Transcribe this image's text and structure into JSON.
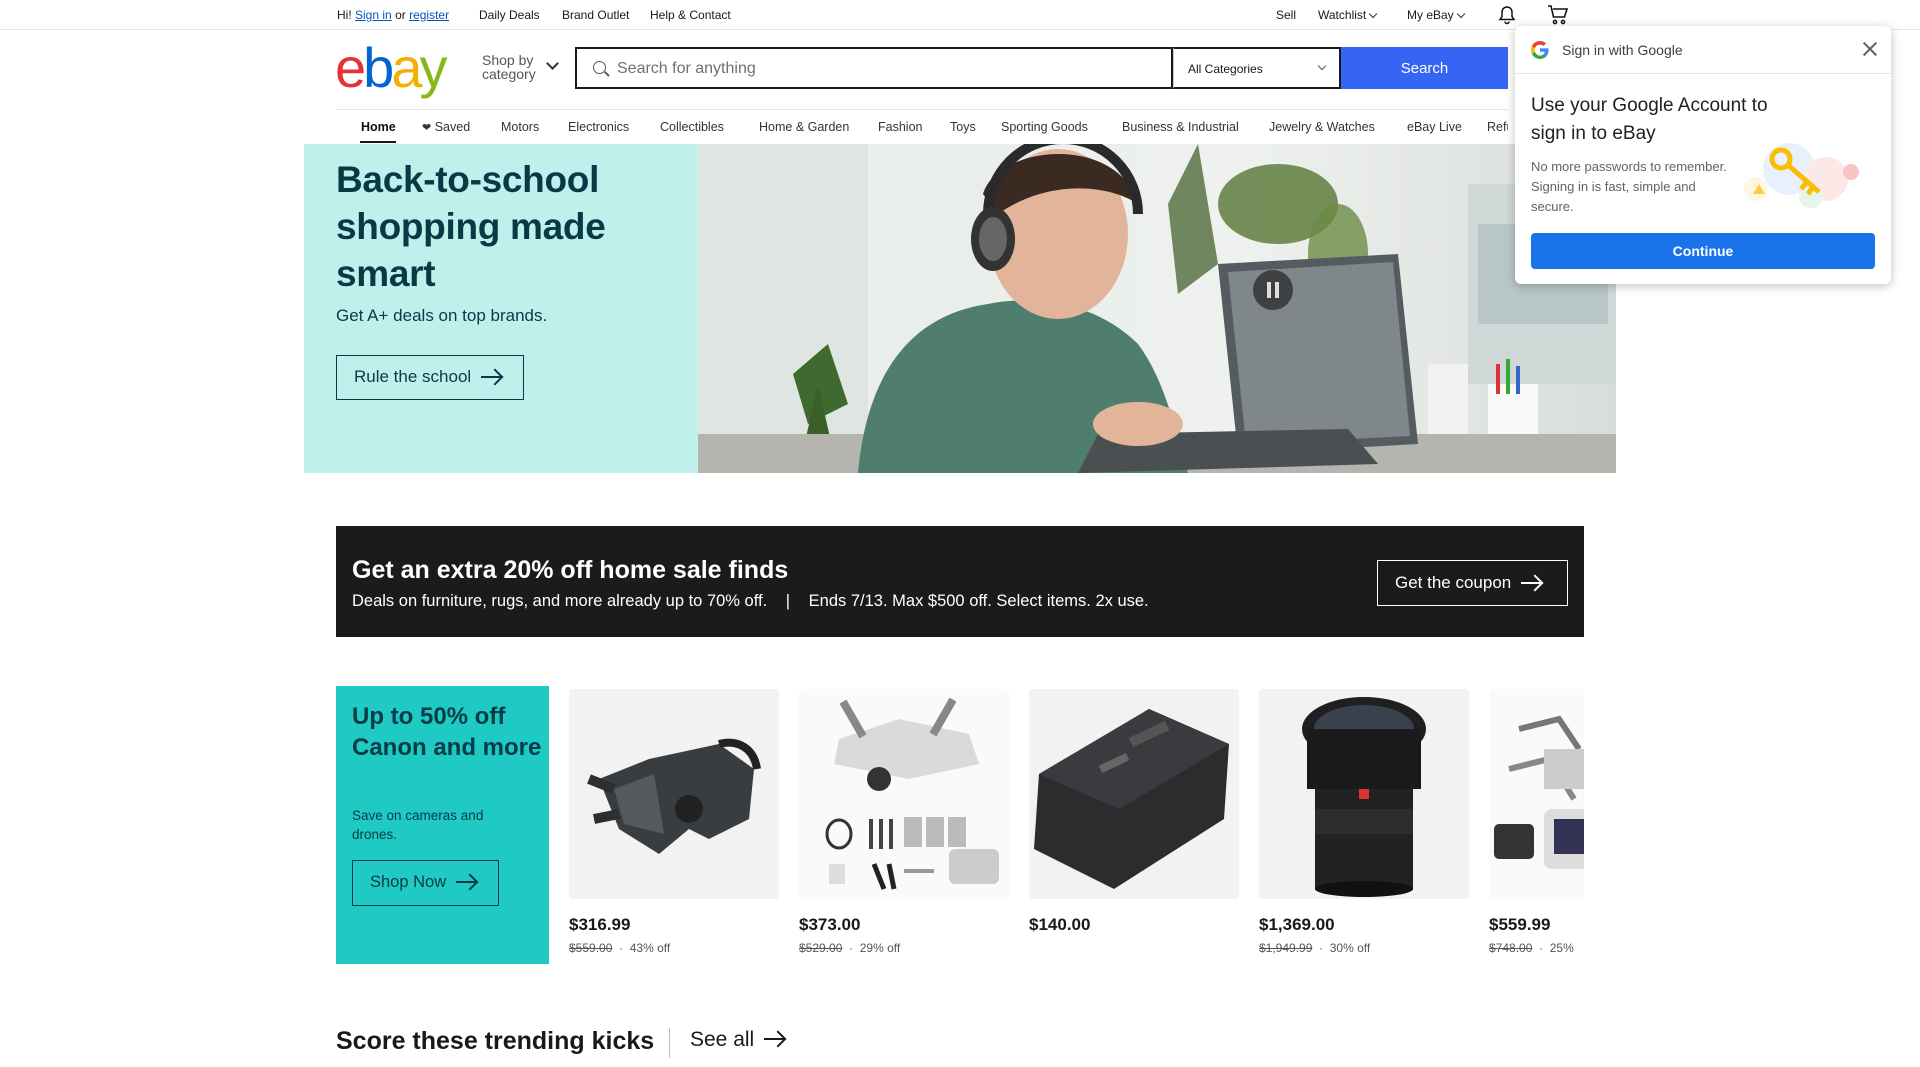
{
  "topbar": {
    "greeting": "Hi!",
    "sign_in": "Sign in",
    "or": "or",
    "register": "register",
    "links": [
      "Daily Deals",
      "Brand Outlet",
      "Help & Contact"
    ],
    "sell": "Sell",
    "watchlist": "Watchlist",
    "my_ebay": "My eBay",
    "notification_icon": "bell-icon",
    "cart_icon": "cart-icon"
  },
  "header": {
    "logo": {
      "e": "e",
      "b": "b",
      "a": "a",
      "y": "y",
      "colors": [
        "#e53238",
        "#0064d2",
        "#f5af02",
        "#86b817"
      ]
    },
    "shop_by_line1": "Shop by",
    "shop_by_line2": "category",
    "search_placeholder": "Search for anything",
    "category_select": "All Categories",
    "search_button": "Search",
    "accent_color": "#3665f3"
  },
  "nav": {
    "tabs": [
      "Home",
      "Saved",
      "Motors",
      "Electronics",
      "Collectibles",
      "Home & Garden",
      "Fashion",
      "Toys",
      "Sporting Goods",
      "Business & Industrial",
      "Jewelry & Watches",
      "eBay Live",
      "Refu"
    ],
    "active": "Home"
  },
  "hero": {
    "title": "Back-to-school shopping made smart",
    "subtitle": "Get A+ deals on top brands.",
    "button": "Rule the school",
    "bg_color": "#c0f0ec",
    "pause_icon": "pause-icon"
  },
  "promo": {
    "title": "Get an extra 20% off home sale finds",
    "sub_left": "Deals on furniture, rugs, and more already up to 70% off.",
    "separator": "|",
    "sub_right": "Ends 7/13. Max $500 off. Select items. 2x use.",
    "button": "Get the coupon"
  },
  "camera_deals": {
    "title": "Up to 50% off Canon and more",
    "subtitle": "Save on cameras and drones.",
    "button": "Shop Now",
    "bg_color": "#1fcac5",
    "products": [
      {
        "price": "$316.99",
        "old_price": "$559.00",
        "discount": "43% off",
        "image": "fpv-goggles"
      },
      {
        "price": "$373.00",
        "old_price": "$529.00",
        "discount": "29% off",
        "image": "drone-combo-kit"
      },
      {
        "price": "$140.00",
        "old_price": "",
        "discount": "",
        "image": "drone-battery"
      },
      {
        "price": "$1,369.00",
        "old_price": "$1,949.99",
        "discount": "30% off",
        "image": "camera-lens"
      },
      {
        "price": "$559.99",
        "old_price": "$748.00",
        "discount": "25%",
        "image": "drone-with-controller"
      }
    ]
  },
  "trending": {
    "title": "Score these trending kicks",
    "see_all": "See all"
  },
  "google_popup": {
    "header": "Sign in with Google",
    "title": "Use your Google Account to sign in to eBay",
    "description": "No more passwords to remember. Signing in is fast, simple and secure.",
    "button": "Continue"
  }
}
